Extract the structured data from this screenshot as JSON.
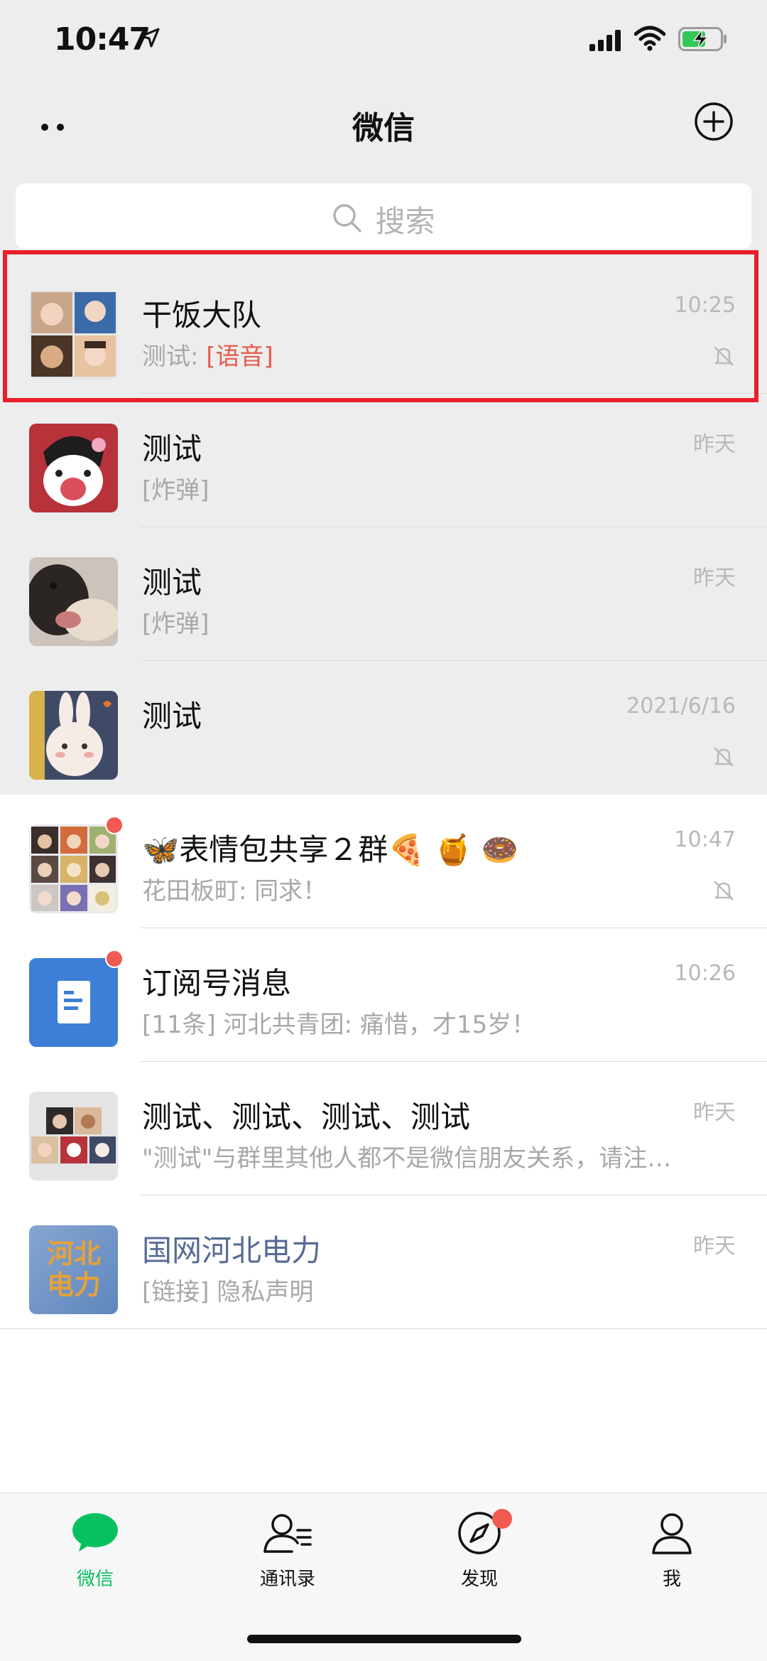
{
  "status_bar": {
    "time": "10:47"
  },
  "header": {
    "title": "微信"
  },
  "search": {
    "placeholder": "搜索"
  },
  "chats": [
    {
      "name": "干饭大队",
      "preview_prefix": "测试: ",
      "preview_tag": "[语音]",
      "time": "10:25",
      "muted": true,
      "pinned": true,
      "highlighted": true,
      "avatar": "group-collage-avatar"
    },
    {
      "name": "测试",
      "preview": "[炸弹]",
      "time": "昨天",
      "muted": false,
      "pinned": true,
      "avatar": "cartoon-avatar"
    },
    {
      "name": "测试",
      "preview": "[炸弹]",
      "time": "昨天",
      "muted": false,
      "pinned": true,
      "avatar": "dog-photo-avatar"
    },
    {
      "name": "测试",
      "preview": "",
      "time": "2021/6/16",
      "muted": true,
      "pinned": true,
      "avatar": "rabbit-avatar"
    },
    {
      "name": "🦋表情包共享２群🍕 🍯 🍩",
      "preview": "花田板町: 同求！",
      "time": "10:47",
      "muted": true,
      "unread_dot": true,
      "avatar": "group-collage-avatar"
    },
    {
      "name": "订阅号消息",
      "preview": "[11条] 河北共青团: 痛惜，才15岁！",
      "time": "10:26",
      "muted": false,
      "unread_dot": true,
      "avatar": "subscription-icon"
    },
    {
      "name": "测试、测试、测试、测试",
      "preview": "\"测试\"与群里其他人都不是微信朋友关系，请注…",
      "time": "昨天",
      "muted": false,
      "avatar": "group-collage-avatar"
    },
    {
      "name": "国网河北电力",
      "preview": "[链接] 隐私声明",
      "time": "昨天",
      "muted": false,
      "official": true,
      "avatar": "logo-avatar",
      "avatar_text": "河北电力"
    }
  ],
  "tabs": [
    {
      "label": "微信",
      "active": true
    },
    {
      "label": "通讯录",
      "active": false
    },
    {
      "label": "发现",
      "active": false,
      "dot": true
    },
    {
      "label": "我",
      "active": false
    }
  ],
  "colors": {
    "accent": "#07c160",
    "highlight": "#e8202b",
    "unread": "#f05a50",
    "official_name": "#576b95"
  }
}
